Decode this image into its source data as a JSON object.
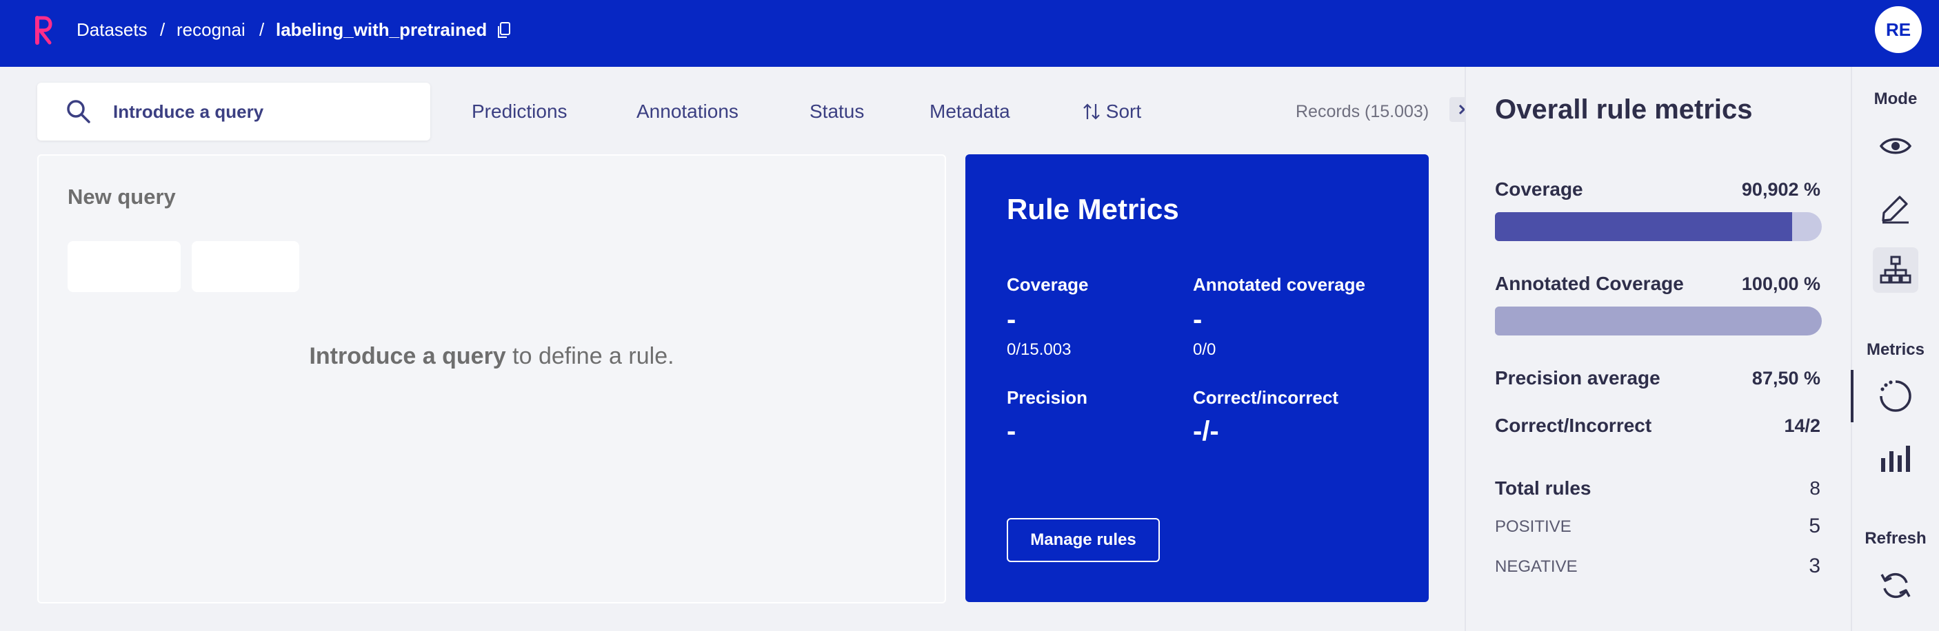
{
  "topbar": {
    "breadcrumbs": [
      "Datasets",
      "recognai",
      "labeling_with_pretrained"
    ],
    "separator": "/",
    "avatar_initials": "RE",
    "background": "#0727c3"
  },
  "search": {
    "placeholder": "Introduce a query"
  },
  "filters": {
    "items": [
      "Predictions",
      "Annotations",
      "Status",
      "Metadata"
    ],
    "sort_label": "Sort",
    "records_label": "Records (15.003)"
  },
  "query_card": {
    "title": "New query",
    "hint_bold": "Introduce a query",
    "hint_rest": " to define a rule."
  },
  "rule_metrics": {
    "title": "Rule Metrics",
    "coverage": {
      "label": "Coverage",
      "value": "-",
      "sub": "0/15.003"
    },
    "annotated_coverage": {
      "label": "Annotated coverage",
      "value": "-",
      "sub": "0/0"
    },
    "precision": {
      "label": "Precision",
      "value": "-"
    },
    "correct_incorrect": {
      "label": "Correct/incorrect",
      "value": "-/-"
    },
    "manage_button": "Manage rules"
  },
  "overall": {
    "title": "Overall rule metrics",
    "coverage": {
      "label": "Coverage",
      "value": "90,902 %",
      "fraction": 0.909,
      "bar_color": "#4b4fa8",
      "track_color": "#c7c9e3"
    },
    "annotated_coverage": {
      "label": "Annotated Coverage",
      "value": "100,00 %",
      "fraction": 1.0,
      "bar_color": "#a2a4cc",
      "track_color": "#c7c9e3"
    },
    "precision_average": {
      "label": "Precision average",
      "value": "87,50 %"
    },
    "correct_incorrect": {
      "label": "Correct/Incorrect",
      "value": "14/2"
    },
    "total_rules": {
      "label": "Total rules",
      "value": "8"
    },
    "positive": {
      "label": "POSITIVE",
      "value": "5"
    },
    "negative": {
      "label": "NEGATIVE",
      "value": "3"
    }
  },
  "mode_bar": {
    "mode_label": "Mode",
    "metrics_label": "Metrics",
    "refresh_label": "Refresh",
    "icons": [
      "eye-icon",
      "pencil-icon",
      "hierarchy-icon",
      "progress-circle-icon",
      "bar-chart-icon",
      "refresh-icon"
    ]
  }
}
